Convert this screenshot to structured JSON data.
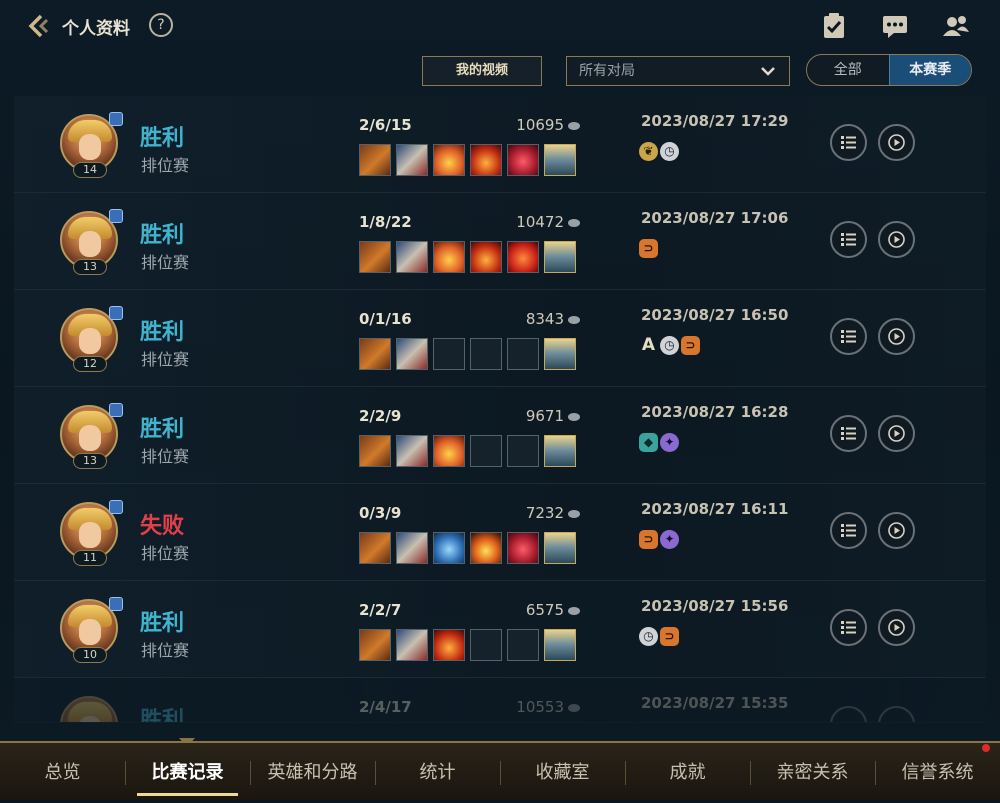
{
  "header": {
    "title": "个人资料",
    "help_icon": "?"
  },
  "filters": {
    "video_button": "我的视频",
    "select_value": "所有对局",
    "seg_all": "全部",
    "seg_season": "本赛季"
  },
  "matches": [
    {
      "level": "14",
      "result": "胜利",
      "mode": "排位赛",
      "kda": "2/6/15",
      "gold": "10695",
      "date": "2023/08/27 17:29"
    },
    {
      "level": "13",
      "result": "胜利",
      "mode": "排位赛",
      "kda": "1/8/22",
      "gold": "10472",
      "date": "2023/08/27 17:06"
    },
    {
      "level": "12",
      "result": "胜利",
      "mode": "排位赛",
      "kda": "0/1/16",
      "gold": "8343",
      "date": "2023/08/27 16:50"
    },
    {
      "level": "13",
      "result": "胜利",
      "mode": "排位赛",
      "kda": "2/2/9",
      "gold": "9671",
      "date": "2023/08/27 16:28"
    },
    {
      "level": "11",
      "result": "失败",
      "mode": "排位赛",
      "kda": "0/3/9",
      "gold": "7232",
      "date": "2023/08/27 16:11"
    },
    {
      "level": "10",
      "result": "胜利",
      "mode": "排位赛",
      "kda": "2/2/7",
      "gold": "6575",
      "date": "2023/08/27 15:56"
    },
    {
      "level": "",
      "result": "胜利",
      "mode": "",
      "kda": "2/4/17",
      "gold": "10553",
      "date": "2023/08/27 15:35"
    }
  ],
  "nav": [
    "总览",
    "比赛记录",
    "英雄和分路",
    "统计",
    "收藏室",
    "成就",
    "亲密关系",
    "信誉系统"
  ],
  "colors": {
    "win": "#40b4cf",
    "loss": "#e0404a",
    "accent": "#8a7444",
    "active_seg": "#1a4d78"
  }
}
